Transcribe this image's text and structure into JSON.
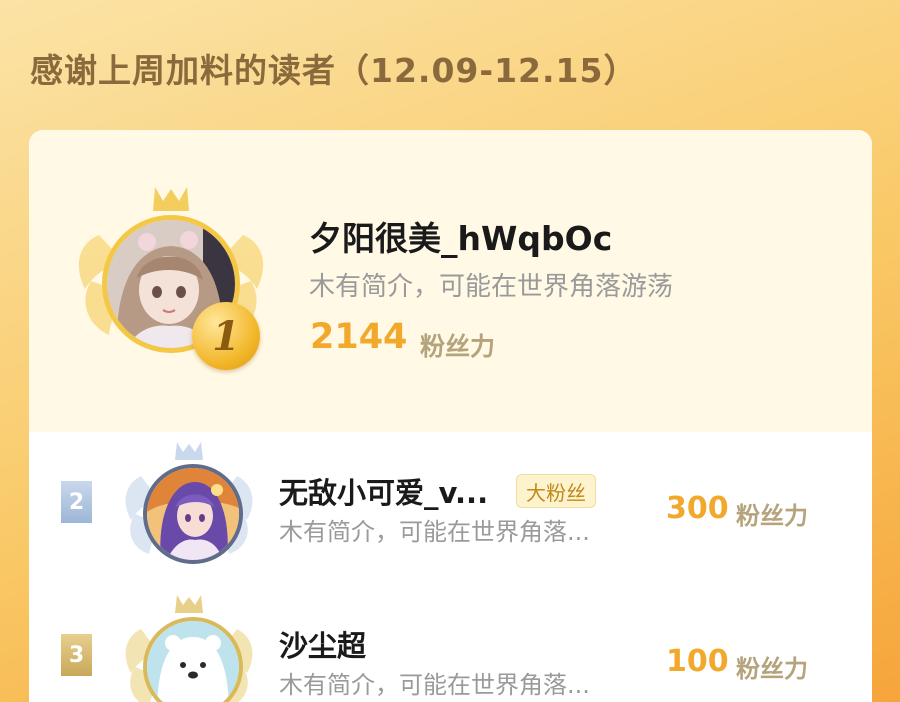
{
  "header": {
    "title": "感谢上周加料的读者（12.09-12.15）"
  },
  "top_reader": {
    "rank": "1",
    "name": "夕阳很美_hWqbOc",
    "bio": "木有简介，可能在世界角落游荡",
    "score": "2144",
    "score_unit": "粉丝力"
  },
  "readers": [
    {
      "rank": "2",
      "name": "无敌小可爱_v...",
      "tag": "大粉丝",
      "bio": "木有简介，可能在世界角落...",
      "score": "300",
      "score_unit": "粉丝力"
    },
    {
      "rank": "3",
      "name": "沙尘超",
      "bio": "木有简介，可能在世界角落...",
      "score": "100",
      "score_unit": "粉丝力"
    }
  ],
  "colors": {
    "gold": "#f2a82b",
    "background_top": "#fbe3a6",
    "background_bottom": "#f6a53a",
    "silver_badge": "#9db6d6",
    "bronze_badge": "#c9a85a"
  }
}
